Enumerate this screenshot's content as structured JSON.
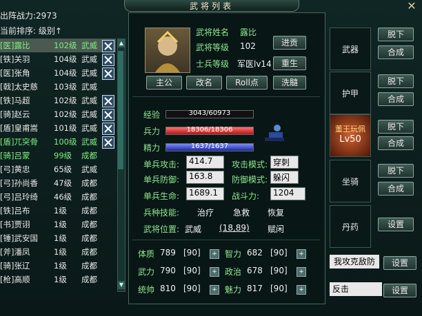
{
  "header": {
    "title": "武将列表",
    "close": "✕"
  },
  "summary": {
    "power_label": "出阵战力:2973",
    "sort_label": "当前排序: 级别↑"
  },
  "generals": [
    {
      "name": "[医]露比",
      "level": "102级",
      "pos": "武威",
      "selected": true,
      "green": true
    },
    {
      "name": "[铁]关羽",
      "level": "104级",
      "pos": "武威"
    },
    {
      "name": "[医]张角",
      "level": "104级",
      "pos": "武威"
    },
    {
      "name": "[戟]太史慈",
      "level": "103级",
      "pos": "武威"
    },
    {
      "name": "[铁]马超",
      "level": "102级",
      "pos": "武威"
    },
    {
      "name": "[骑]赵云",
      "level": "102级",
      "pos": "武威"
    },
    {
      "name": "[盾]皇甫嵩",
      "level": "101级",
      "pos": "武威"
    },
    {
      "name": "[盾]兀突骨",
      "level": "100级",
      "pos": "武威",
      "green": true
    },
    {
      "name": "[骑]吕蒙",
      "level": "99级",
      "pos": "成都",
      "green": true
    },
    {
      "name": "[弓]黄忠",
      "level": "65级",
      "pos": "武威"
    },
    {
      "name": "[弓]孙尚香",
      "level": "47级",
      "pos": "成都"
    },
    {
      "name": "[弓]吕玲绮",
      "level": "46级",
      "pos": "成都"
    },
    {
      "name": "[铁]吕布",
      "level": "1级",
      "pos": "成都"
    },
    {
      "name": "[书]贾诩",
      "level": "1级",
      "pos": "成都"
    },
    {
      "name": "[锤]武安国",
      "level": "1级",
      "pos": "成都"
    },
    {
      "name": "[斧]潘凤",
      "level": "1级",
      "pos": "成都"
    },
    {
      "name": "[骑]张辽",
      "level": "1级",
      "pos": "成都"
    },
    {
      "name": "[枪]高顺",
      "level": "1级",
      "pos": "成都"
    }
  ],
  "detail": {
    "name_label": "武将姓名",
    "name_value": "露比",
    "level_label": "武将等级",
    "level_value": "102",
    "soldier_label": "士兵等级",
    "soldier_value": "军医lv14",
    "btn_advance": "进贡",
    "btn_rebirth": "重生",
    "btn_lord": "主公",
    "btn_rename": "改名",
    "btn_roll": "Roll点",
    "btn_wash": "洗髓",
    "exp_label": "经验",
    "exp_value": "3043/60973",
    "exp_ratio": 0.05,
    "hp_label": "兵力",
    "hp_value": "18306/18306",
    "hp_ratio": 1.0,
    "mp_label": "精力",
    "mp_value": "1637/1637",
    "mp_ratio": 1.0,
    "atk_label": "单兵攻击:",
    "atk_value": "414.7",
    "atk_mode_label": "攻击模式:",
    "atk_mode_value": "穿刺",
    "def_label": "单兵防御:",
    "def_value": "163.8",
    "def_mode_label": "防御模式:",
    "def_mode_value": "躲闪",
    "life_label": "单兵生命:",
    "life_value": "1689.1",
    "power_label": "战斗力:",
    "power_value": "1204",
    "skill_label": "兵种技能:",
    "skills": [
      "治疗",
      "急救",
      "恢复"
    ],
    "loc_label": "武将位置:",
    "loc_value": "武威",
    "loc_coord": "(18,89)",
    "loc_action": "赋闲",
    "attrs": [
      {
        "l1": "体质",
        "v1": "789",
        "b1": "[90]",
        "l2": "智力",
        "v2": "682",
        "b2": "[90]"
      },
      {
        "l1": "武力",
        "v1": "790",
        "b1": "[90]",
        "l2": "政治",
        "v2": "678",
        "b2": "[90]"
      },
      {
        "l1": "统帅",
        "v1": "810",
        "b1": "[90]",
        "l2": "魅力",
        "v2": "817",
        "b2": "[90]"
      }
    ]
  },
  "equipment": {
    "weapon": "武器",
    "armor": "护甲",
    "accessory_name": "董王玩佩",
    "accessory_level": "Lv50",
    "mount": "坐骑",
    "medicine": "丹药",
    "unequip": "脱下",
    "combine": "合成",
    "setting": "设置",
    "strategy1": "我攻克敌防",
    "strategy2": "反击"
  }
}
